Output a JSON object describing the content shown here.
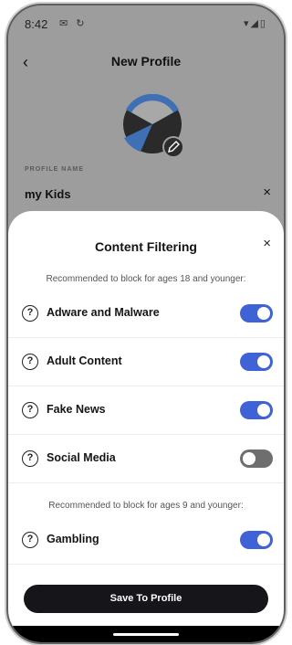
{
  "status_bar": {
    "time": "8:42",
    "notification_icons": "✉ ↻",
    "system_icons": "▾◢▯"
  },
  "header": {
    "back_icon": "‹",
    "title": "New Profile"
  },
  "avatar": {
    "icon": "wifi-shield-icon",
    "edit_icon": "pencil-icon",
    "colors": {
      "primary": "#2a2a2a",
      "accent": "#3f6fb5"
    }
  },
  "profile_name": {
    "label": "PROFILE NAME",
    "value": "my Kids",
    "clear_icon": "×"
  },
  "sheet": {
    "title": "Content Filtering",
    "close_icon": "×",
    "note_older": "Recommended to block for ages 18 and younger:",
    "note_younger": "Recommended to block for ages 9 and younger:",
    "help_icon": "?",
    "filters": [
      {
        "label": "Adware and Malware",
        "enabled": true
      },
      {
        "label": "Adult Content",
        "enabled": true
      },
      {
        "label": "Fake News",
        "enabled": true
      },
      {
        "label": "Social Media",
        "enabled": false
      },
      {
        "label": "Gambling",
        "enabled": true
      }
    ],
    "save_label": "Save To Profile"
  },
  "colors": {
    "toggle_on": "#3f63d6",
    "toggle_off": "#6e6e6e",
    "button": "#15151a"
  }
}
